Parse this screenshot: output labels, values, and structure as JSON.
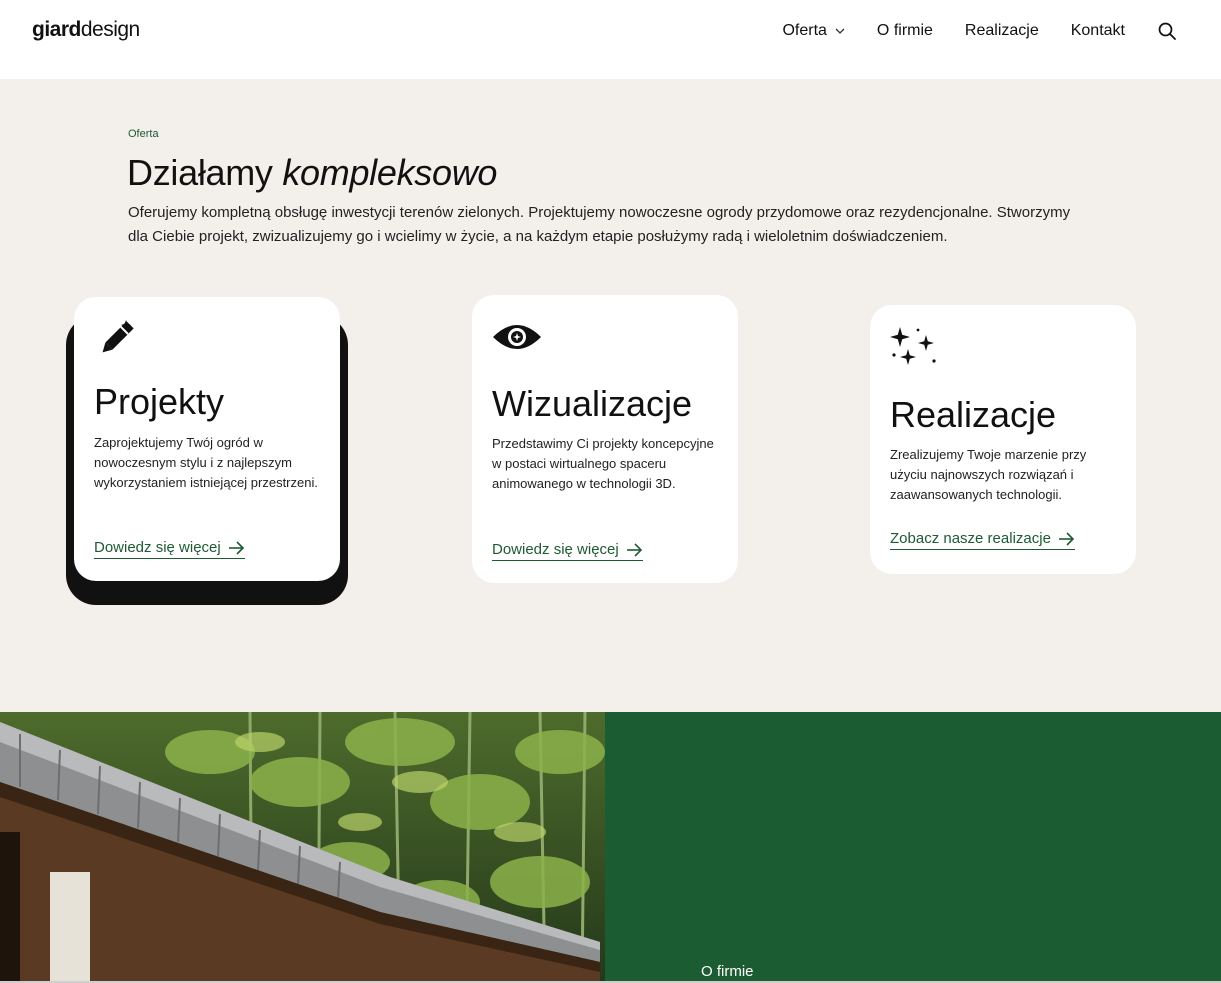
{
  "header": {
    "logo_bold": "giard",
    "logo_light": "design",
    "nav": [
      {
        "label": "Oferta",
        "has_dropdown": true
      },
      {
        "label": "O firmie"
      },
      {
        "label": "Realizacje"
      },
      {
        "label": "Kontakt"
      }
    ],
    "search_icon": "search-icon"
  },
  "offer": {
    "eyebrow": "Oferta",
    "title_plain": "Działamy ",
    "title_italic": "kompleksowo",
    "lead": "Oferujemy kompletną obsługę inwestycji terenów zielonych. Projektujemy nowoczesne ogrody przydomowe oraz rezydencjonalne. Stworzymy dla Ciebie projekt, zwizualizujemy go i wcielimy w życie, a na każdym etapie posłużymy radą i wieloletnim doświadczeniem.",
    "cards": [
      {
        "icon": "pencil-sparkle-icon",
        "title": "Projekty",
        "text": "Zaprojektujemy Twój ogród w nowoczesnym stylu i z najlepszym wykorzystaniem istniejącej przestrzeni.",
        "link": "Dowiedz się więcej"
      },
      {
        "icon": "eye-icon",
        "title": "Wizualizacje",
        "text": "Przedstawimy Ci projekty koncepcyjne w postaci wirtualnego spaceru animowanego w technologii 3D.",
        "link": "Dowiedz się więcej"
      },
      {
        "icon": "sparkles-icon",
        "title": "Realizacje",
        "text": "Zrealizujemy Twoje marzenie przy użyciu najnowszych rozwiązań i zaawansowanych technologii.",
        "link": "Zobacz nasze realizacje"
      }
    ]
  },
  "about": {
    "label": "O firmie"
  },
  "colors": {
    "accent_green": "#1c5c32",
    "link_green": "#1e5a32",
    "beige": "#f3efeb"
  }
}
